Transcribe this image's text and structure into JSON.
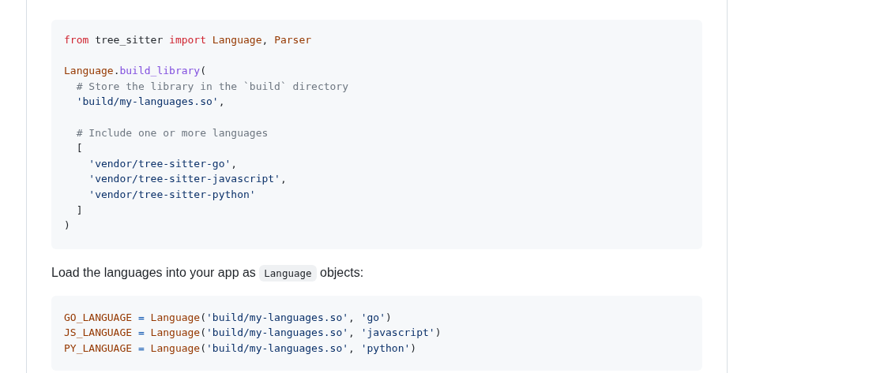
{
  "code_block_1": {
    "groups": [
      {
        "lines": [
          {
            "tokens": [
              {
                "kind": "kw",
                "text": "from"
              },
              {
                "kind": "plain",
                "text": " tree_sitter "
              },
              {
                "kind": "kw",
                "text": "import"
              },
              {
                "kind": "name",
                "text": " Language"
              },
              {
                "kind": "plain",
                "text": ", "
              },
              {
                "kind": "name",
                "text": "Parser"
              }
            ]
          }
        ]
      },
      {
        "lines": [
          {
            "tokens": [
              {
                "kind": "name",
                "text": "Language"
              },
              {
                "kind": "plain",
                "text": "."
              },
              {
                "kind": "func",
                "text": "build_library"
              },
              {
                "kind": "plain",
                "text": "("
              }
            ]
          },
          {
            "tokens": [
              {
                "kind": "comment",
                "text": "  # Store the library in the `build` directory"
              }
            ]
          },
          {
            "tokens": [
              {
                "kind": "str",
                "text": "  'build/my-languages.so'"
              },
              {
                "kind": "plain",
                "text": ","
              }
            ]
          }
        ]
      },
      {
        "lines": [
          {
            "tokens": [
              {
                "kind": "comment",
                "text": "  # Include one or more languages"
              }
            ]
          },
          {
            "tokens": [
              {
                "kind": "plain",
                "text": "  ["
              }
            ]
          },
          {
            "tokens": [
              {
                "kind": "str",
                "text": "    'vendor/tree-sitter-go'"
              },
              {
                "kind": "plain",
                "text": ","
              }
            ]
          },
          {
            "tokens": [
              {
                "kind": "str",
                "text": "    'vendor/tree-sitter-javascript'"
              },
              {
                "kind": "plain",
                "text": ","
              }
            ]
          },
          {
            "tokens": [
              {
                "kind": "str",
                "text": "    'vendor/tree-sitter-python'"
              }
            ]
          },
          {
            "tokens": [
              {
                "kind": "plain",
                "text": "  ]"
              }
            ]
          },
          {
            "tokens": [
              {
                "kind": "plain",
                "text": ")"
              }
            ]
          }
        ]
      }
    ]
  },
  "paragraph": {
    "before": "Load the languages into your app as",
    "code": "Language",
    "after": "objects:"
  },
  "code_block_2": {
    "groups": [
      {
        "lines": [
          {
            "tokens": [
              {
                "kind": "name",
                "text": "GO_LANGUAGE "
              },
              {
                "kind": "op",
                "text": "="
              },
              {
                "kind": "name",
                "text": " Language"
              },
              {
                "kind": "plain",
                "text": "("
              },
              {
                "kind": "str",
                "text": "'build/my-languages.so'"
              },
              {
                "kind": "plain",
                "text": ", "
              },
              {
                "kind": "str",
                "text": "'go'"
              },
              {
                "kind": "plain",
                "text": ")"
              }
            ]
          },
          {
            "tokens": [
              {
                "kind": "name",
                "text": "JS_LANGUAGE "
              },
              {
                "kind": "op",
                "text": "="
              },
              {
                "kind": "name",
                "text": " Language"
              },
              {
                "kind": "plain",
                "text": "("
              },
              {
                "kind": "str",
                "text": "'build/my-languages.so'"
              },
              {
                "kind": "plain",
                "text": ", "
              },
              {
                "kind": "str",
                "text": "'javascript'"
              },
              {
                "kind": "plain",
                "text": ")"
              }
            ]
          },
          {
            "tokens": [
              {
                "kind": "name",
                "text": "PY_LANGUAGE "
              },
              {
                "kind": "op",
                "text": "="
              },
              {
                "kind": "name",
                "text": " Language"
              },
              {
                "kind": "plain",
                "text": "("
              },
              {
                "kind": "str",
                "text": "'build/my-languages.so'"
              },
              {
                "kind": "plain",
                "text": ", "
              },
              {
                "kind": "str",
                "text": "'python'"
              },
              {
                "kind": "plain",
                "text": ")"
              }
            ]
          }
        ]
      }
    ]
  }
}
